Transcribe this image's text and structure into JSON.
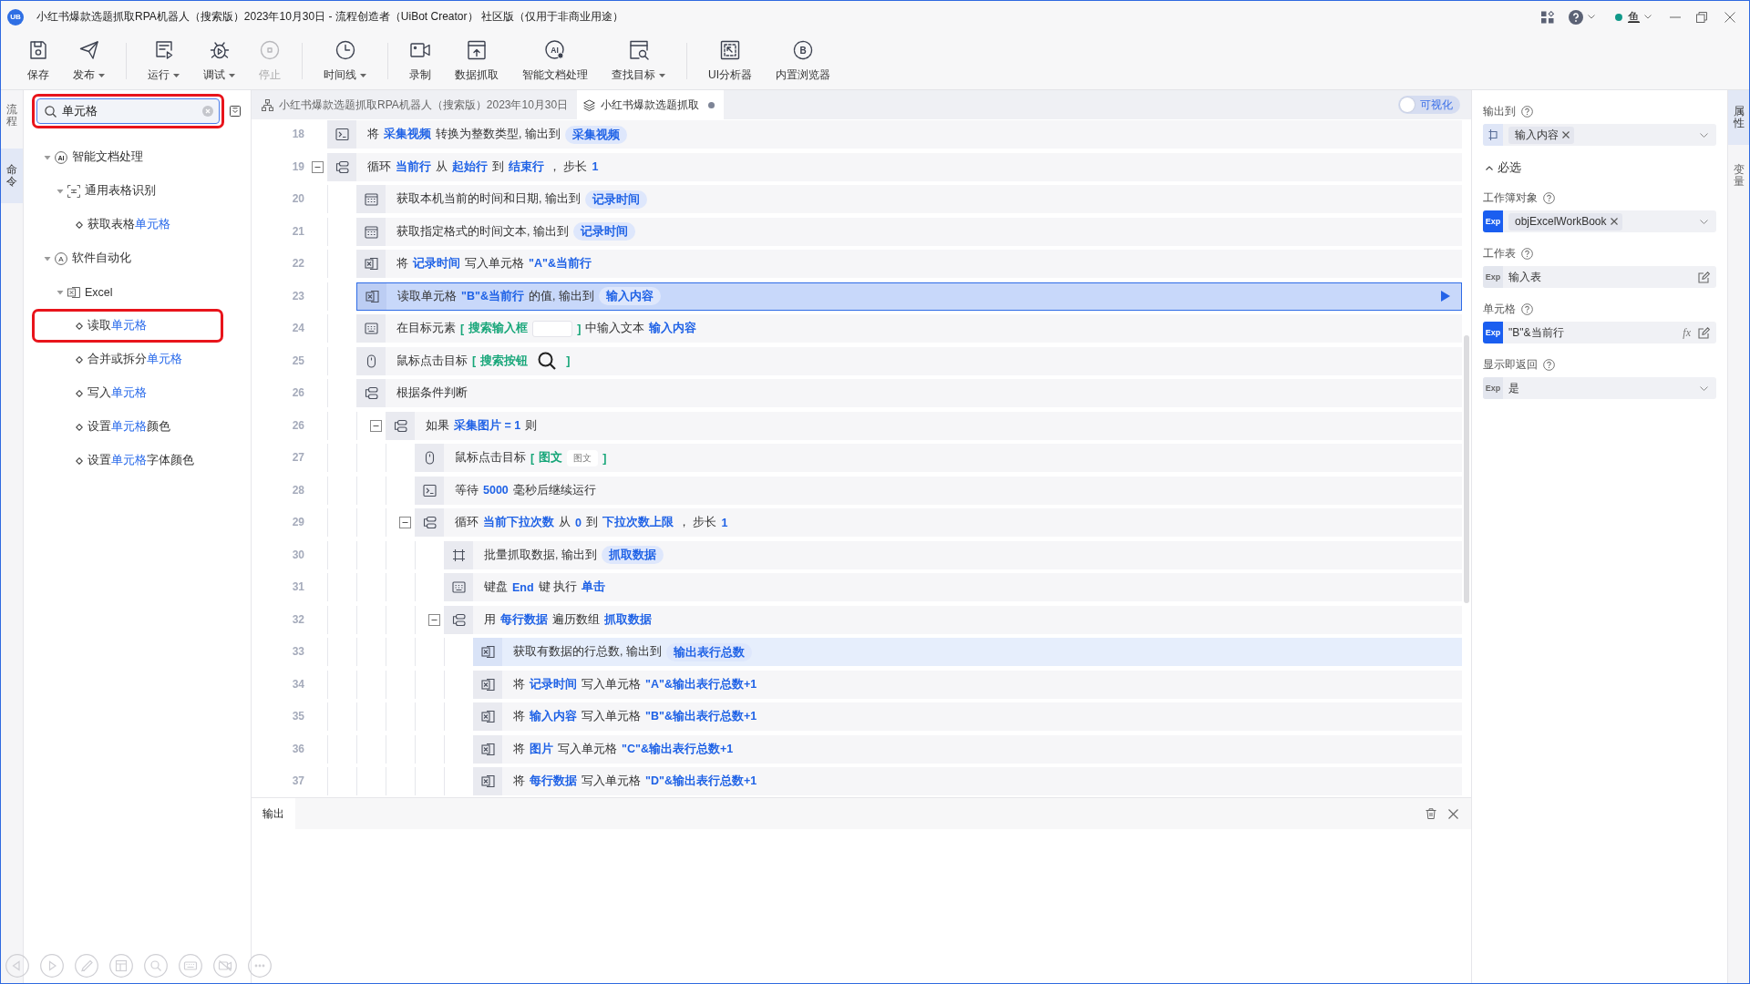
{
  "window": {
    "logo": "UB",
    "title": "小红书爆款选题抓取RPA机器人（搜索版）2023年10月30日 - 流程创造者（UiBot Creator） 社区版（仅用于非商业用途）",
    "user": {
      "name": "鱼",
      "online": true
    }
  },
  "toolbar": {
    "groups": [
      {
        "items": [
          {
            "label": "保存",
            "kind": "save",
            "has_menu": false,
            "disabled": false
          },
          {
            "label": "发布",
            "kind": "publish",
            "has_menu": true,
            "disabled": false
          }
        ]
      },
      {
        "items": [
          {
            "label": "运行",
            "kind": "run",
            "has_menu": true,
            "disabled": false
          },
          {
            "label": "调试",
            "kind": "debug",
            "has_menu": true,
            "disabled": false
          },
          {
            "label": "停止",
            "kind": "stop",
            "has_menu": false,
            "disabled": true
          }
        ]
      },
      {
        "items": [
          {
            "label": "时间线",
            "kind": "timeline",
            "has_menu": true,
            "disabled": false
          }
        ]
      },
      {
        "items": [
          {
            "label": "录制",
            "kind": "record",
            "has_menu": false,
            "disabled": false
          },
          {
            "label": "数据抓取",
            "kind": "scrape",
            "has_menu": false,
            "disabled": false
          },
          {
            "label": "智能文档处理",
            "kind": "ai-doc",
            "glyph": "AI",
            "has_menu": false,
            "disabled": false
          },
          {
            "label": "查找目标",
            "kind": "find-target",
            "has_menu": true,
            "disabled": false
          }
        ]
      },
      {
        "items": [
          {
            "label": "UI分析器",
            "kind": "ui-analyzer",
            "has_menu": false,
            "disabled": false
          },
          {
            "label": "内置浏览器",
            "kind": "browser",
            "glyph": "B",
            "has_menu": false,
            "disabled": false
          }
        ]
      }
    ]
  },
  "left_tabs": [
    {
      "label": "流程",
      "selected": false
    },
    {
      "label": "命令",
      "selected": true
    }
  ],
  "command_panel": {
    "search": {
      "value": "单元格",
      "marked": true
    },
    "tree": [
      {
        "kind": "ai-category",
        "glyph": "AI",
        "parts": [
          {
            "text": "智能文档处理",
            "match": false
          }
        ],
        "expanded": true,
        "marked": false,
        "children": [
          {
            "kind": "table-ocr",
            "parts": [
              {
                "text": "通用表格识别",
                "match": false
              }
            ],
            "expanded": true,
            "marked": false,
            "children": [
              {
                "kind": "command",
                "parts": [
                  {
                    "text": "获取表格",
                    "match": false
                  },
                  {
                    "text": "单元格",
                    "match": true
                  }
                ],
                "marked": false
              }
            ]
          }
        ]
      },
      {
        "kind": "automation-category",
        "glyph": "A",
        "parts": [
          {
            "text": "软件自动化",
            "match": false
          }
        ],
        "expanded": true,
        "marked": false,
        "children": [
          {
            "kind": "excel",
            "parts": [
              {
                "text": "Excel",
                "match": false
              }
            ],
            "expanded": true,
            "marked": false,
            "children": [
              {
                "kind": "command",
                "parts": [
                  {
                    "text": "读取",
                    "match": false
                  },
                  {
                    "text": "单元格",
                    "match": true
                  }
                ],
                "marked": true
              },
              {
                "kind": "command",
                "parts": [
                  {
                    "text": "合并或拆分",
                    "match": false
                  },
                  {
                    "text": "单元格",
                    "match": true
                  }
                ],
                "marked": false
              },
              {
                "kind": "command",
                "parts": [
                  {
                    "text": "写入",
                    "match": false
                  },
                  {
                    "text": "单元格",
                    "match": true
                  }
                ],
                "marked": false
              },
              {
                "kind": "command",
                "parts": [
                  {
                    "text": "设置",
                    "match": false
                  },
                  {
                    "text": "单元格",
                    "match": true
                  },
                  {
                    "text": "颜色",
                    "match": false
                  }
                ],
                "marked": false
              },
              {
                "kind": "command",
                "parts": [
                  {
                    "text": "设置",
                    "match": false
                  },
                  {
                    "text": "单元格",
                    "match": true
                  },
                  {
                    "text": "字体颜色",
                    "match": false
                  }
                ],
                "marked": false
              }
            ]
          }
        ]
      }
    ]
  },
  "editor": {
    "tabs": [
      {
        "label": "小红书爆款选题抓取RPA机器人（搜索版）2023年10月30日",
        "kind": "flow",
        "selected": false,
        "unsaved": false
      },
      {
        "label": "小红书爆款选题抓取",
        "kind": "block",
        "selected": true,
        "unsaved": true
      }
    ],
    "visual_toggle": {
      "label": "可视化",
      "on": false
    },
    "rows": [
      {
        "number": "18",
        "kind": "convert",
        "selected": false,
        "highlighted": false,
        "segments": [
          {
            "kind": "text",
            "text": "将"
          },
          {
            "kind": "var",
            "text": "采集视频"
          },
          {
            "kind": "text",
            "text": "转换为整数类型, 输出到"
          },
          {
            "kind": "pill",
            "text": "采集视频"
          }
        ]
      },
      {
        "number": "19",
        "kind": "loop",
        "expanded": true,
        "selected": false,
        "highlighted": false,
        "segments": [
          {
            "kind": "text",
            "text": "循环"
          },
          {
            "kind": "var",
            "text": "当前行"
          },
          {
            "kind": "text",
            "text": "从"
          },
          {
            "kind": "var",
            "text": "起始行"
          },
          {
            "kind": "text",
            "text": "到"
          },
          {
            "kind": "var",
            "text": "结束行"
          },
          {
            "kind": "text",
            "text": "， 步长"
          },
          {
            "kind": "var",
            "text": "1"
          }
        ],
        "children": [
          {
            "number": "20",
            "kind": "datetime",
            "selected": false,
            "highlighted": false,
            "segments": [
              {
                "kind": "text",
                "text": "获取本机当前的时间和日期, 输出到"
              },
              {
                "kind": "pill",
                "text": "记录时间"
              }
            ]
          },
          {
            "number": "21",
            "kind": "datetime",
            "selected": false,
            "highlighted": false,
            "segments": [
              {
                "kind": "text",
                "text": "获取指定格式的时间文本, 输出到"
              },
              {
                "kind": "pill",
                "text": "记录时间"
              }
            ]
          },
          {
            "number": "22",
            "kind": "excel",
            "selected": false,
            "highlighted": false,
            "segments": [
              {
                "kind": "text",
                "text": "将"
              },
              {
                "kind": "var",
                "text": "记录时间"
              },
              {
                "kind": "text",
                "text": "写入单元格"
              },
              {
                "kind": "var",
                "text": "\"A\"&当前行"
              }
            ]
          },
          {
            "number": "23",
            "kind": "excel",
            "selected": true,
            "highlighted": false,
            "segments": [
              {
                "kind": "text",
                "text": "读取单元格"
              },
              {
                "kind": "var",
                "text": "\"B\"&当前行"
              },
              {
                "kind": "text",
                "text": "的值, 输出到"
              },
              {
                "kind": "pill",
                "text": "输入内容"
              }
            ]
          },
          {
            "number": "24",
            "kind": "keyboard",
            "selected": false,
            "highlighted": false,
            "segments": [
              {
                "kind": "text",
                "text": "在目标元素"
              },
              {
                "kind": "target",
                "open": "[",
                "name": "搜索输入框",
                "preview": {
                  "kind": "blank"
                },
                "close": "]"
              },
              {
                "kind": "text",
                "text": "中输入文本"
              },
              {
                "kind": "var",
                "text": "输入内容"
              }
            ]
          },
          {
            "number": "25",
            "kind": "mouse",
            "selected": false,
            "highlighted": false,
            "segments": [
              {
                "kind": "text",
                "text": "鼠标点击目标"
              },
              {
                "kind": "target",
                "open": "[",
                "name": "搜索按钮",
                "preview": {
                  "kind": "magnifier"
                },
                "close": "]"
              }
            ]
          },
          {
            "number": "26",
            "kind": "condition",
            "selected": false,
            "highlighted": false,
            "segments": [
              {
                "kind": "text",
                "text": "根据条件判断"
              }
            ],
            "children": [
              {
                "number": "26",
                "kind": "condition",
                "expanded": true,
                "selected": false,
                "highlighted": false,
                "segments": [
                  {
                    "kind": "text",
                    "text": "如果"
                  },
                  {
                    "kind": "var",
                    "text": "采集图片 = 1"
                  },
                  {
                    "kind": "text",
                    "text": "则"
                  }
                ],
                "children": [
                  {
                    "number": "27",
                    "kind": "mouse",
                    "selected": false,
                    "highlighted": false,
                    "segments": [
                      {
                        "kind": "text",
                        "text": "鼠标点击目标"
                      },
                      {
                        "kind": "target",
                        "open": "[",
                        "name": "图文",
                        "preview": {
                          "kind": "label",
                          "text": "图文"
                        },
                        "close": "]"
                      }
                    ]
                  },
                  {
                    "number": "28",
                    "kind": "wait",
                    "selected": false,
                    "highlighted": false,
                    "segments": [
                      {
                        "kind": "text",
                        "text": "等待"
                      },
                      {
                        "kind": "var",
                        "text": "5000"
                      },
                      {
                        "kind": "text",
                        "text": "毫秒后继续运行"
                      }
                    ]
                  },
                  {
                    "number": "29",
                    "kind": "loop",
                    "expanded": true,
                    "selected": false,
                    "highlighted": false,
                    "segments": [
                      {
                        "kind": "text",
                        "text": "循环"
                      },
                      {
                        "kind": "var",
                        "text": "当前下拉次数"
                      },
                      {
                        "kind": "text",
                        "text": "从"
                      },
                      {
                        "kind": "var",
                        "text": "0"
                      },
                      {
                        "kind": "text",
                        "text": "到"
                      },
                      {
                        "kind": "var",
                        "text": "下拉次数上限"
                      },
                      {
                        "kind": "text",
                        "text": "， 步长"
                      },
                      {
                        "kind": "var",
                        "text": "1"
                      }
                    ],
                    "children": [
                      {
                        "number": "30",
                        "kind": "scrape",
                        "selected": false,
                        "highlighted": false,
                        "segments": [
                          {
                            "kind": "text",
                            "text": "批量抓取数据, 输出到"
                          },
                          {
                            "kind": "pill",
                            "text": "抓取数据"
                          }
                        ]
                      },
                      {
                        "number": "31",
                        "kind": "keyboard",
                        "selected": false,
                        "highlighted": false,
                        "segments": [
                          {
                            "kind": "text",
                            "text": "键盘"
                          },
                          {
                            "kind": "var",
                            "text": "End"
                          },
                          {
                            "kind": "text",
                            "text": "键 执行"
                          },
                          {
                            "kind": "var",
                            "text": "单击"
                          }
                        ]
                      },
                      {
                        "number": "32",
                        "kind": "foreach",
                        "expanded": true,
                        "selected": false,
                        "highlighted": false,
                        "segments": [
                          {
                            "kind": "text",
                            "text": "用"
                          },
                          {
                            "kind": "var",
                            "text": "每行数据"
                          },
                          {
                            "kind": "text",
                            "text": "遍历数组"
                          },
                          {
                            "kind": "var",
                            "text": "抓取数据"
                          }
                        ],
                        "children": [
                          {
                            "number": "33",
                            "kind": "excel",
                            "selected": false,
                            "highlighted": true,
                            "segments": [
                              {
                                "kind": "text",
                                "text": "获取有数据的行总数, 输出到"
                              },
                              {
                                "kind": "pill",
                                "text": "输出表行总数"
                              }
                            ]
                          },
                          {
                            "number": "34",
                            "kind": "excel",
                            "selected": false,
                            "highlighted": false,
                            "segments": [
                              {
                                "kind": "text",
                                "text": "将"
                              },
                              {
                                "kind": "var",
                                "text": "记录时间"
                              },
                              {
                                "kind": "text",
                                "text": "写入单元格"
                              },
                              {
                                "kind": "var",
                                "text": "\"A\"&输出表行总数+1"
                              }
                            ]
                          },
                          {
                            "number": "35",
                            "kind": "excel",
                            "selected": false,
                            "highlighted": false,
                            "segments": [
                              {
                                "kind": "text",
                                "text": "将"
                              },
                              {
                                "kind": "var",
                                "text": "输入内容"
                              },
                              {
                                "kind": "text",
                                "text": "写入单元格"
                              },
                              {
                                "kind": "var",
                                "text": "\"B\"&输出表行总数+1"
                              }
                            ]
                          },
                          {
                            "number": "36",
                            "kind": "excel",
                            "selected": false,
                            "highlighted": false,
                            "segments": [
                              {
                                "kind": "text",
                                "text": "将"
                              },
                              {
                                "kind": "var",
                                "text": "图片"
                              },
                              {
                                "kind": "text",
                                "text": "写入单元格"
                              },
                              {
                                "kind": "var",
                                "text": "\"C\"&输出表行总数+1"
                              }
                            ]
                          },
                          {
                            "number": "37",
                            "kind": "excel",
                            "selected": false,
                            "highlighted": false,
                            "segments": [
                              {
                                "kind": "text",
                                "text": "将"
                              },
                              {
                                "kind": "var",
                                "text": "每行数据"
                              },
                              {
                                "kind": "text",
                                "text": "写入单元格"
                              },
                              {
                                "kind": "var",
                                "text": "\"D\"&输出表行总数+1"
                              }
                            ]
                          }
                        ]
                      }
                    ]
                  }
                ]
              }
            ]
          }
        ]
      }
    ]
  },
  "output_panel": {
    "tabs": [
      {
        "label": "输出",
        "selected": true
      }
    ]
  },
  "properties": {
    "output_field": {
      "label": "输出到",
      "value": "输入内容"
    },
    "section": {
      "label": "必选",
      "expanded": true,
      "fields": [
        {
          "label": "工作簿对象",
          "kind": "chip-select",
          "badge": "Exp",
          "badge_active": true,
          "value": "objExcelWorkBook"
        },
        {
          "label": "工作表",
          "kind": "edit",
          "badge": "Exp",
          "badge_active": false,
          "value": "输入表"
        },
        {
          "label": "单元格",
          "kind": "formula",
          "badge": "Exp",
          "badge_active": true,
          "value": "\"B\"&当前行",
          "formula_mark": "fx"
        },
        {
          "label": "显示即返回",
          "kind": "select",
          "badge": "Exp",
          "badge_active": false,
          "value": "是"
        }
      ]
    }
  },
  "right_tabs": [
    {
      "label": "属性",
      "selected": true
    },
    {
      "label": "变量",
      "selected": false
    }
  ]
}
